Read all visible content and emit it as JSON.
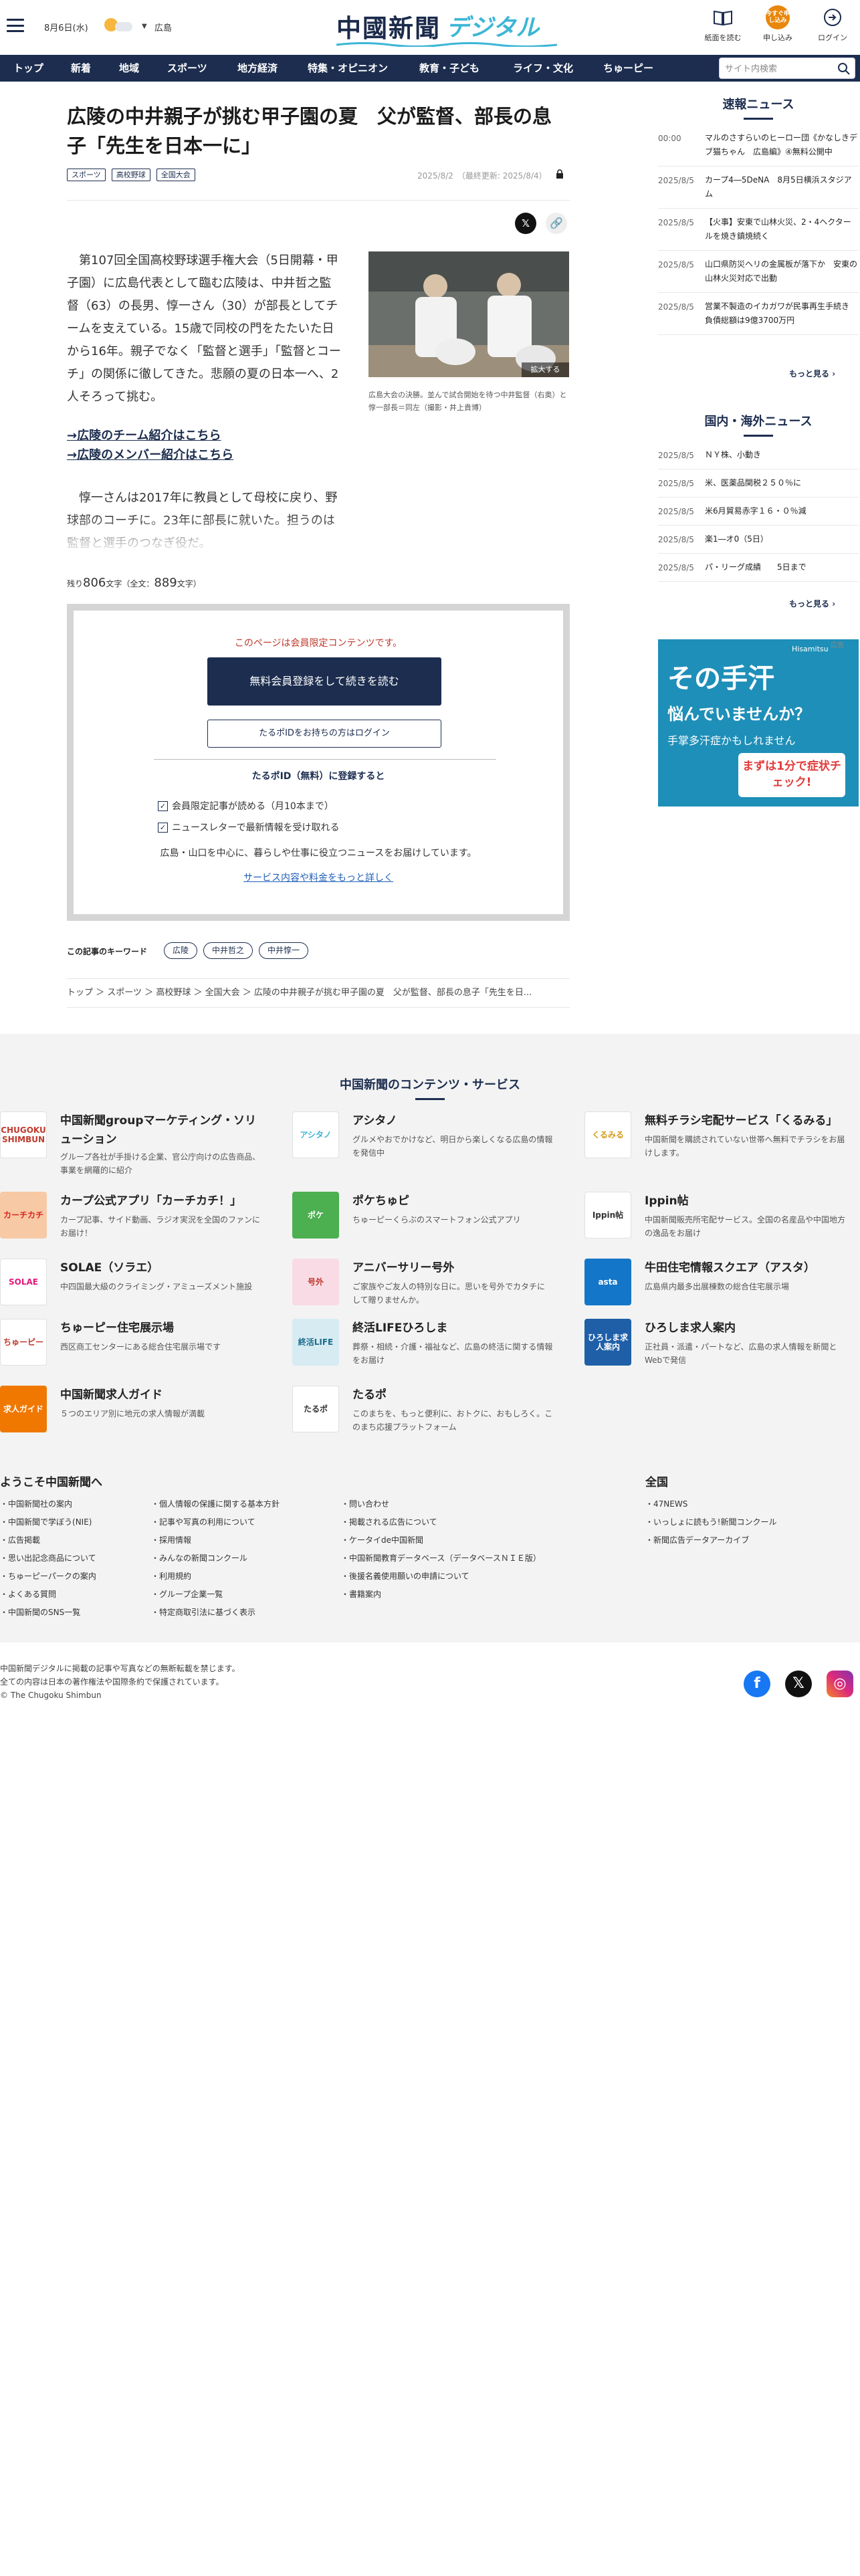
{
  "header": {
    "date": "8月6日(水)",
    "region": "広島",
    "logo_main": "中國新聞",
    "logo_sub": "デジタル",
    "buttons": [
      {
        "label": "紙面を読む",
        "icon": "newspaper-icon"
      },
      {
        "label": "申し込み",
        "icon": "apply-icon",
        "badge": "今すぐ申し込み"
      },
      {
        "label": "ログイン",
        "icon": "login-icon"
      }
    ]
  },
  "nav": {
    "items": [
      "トップ",
      "新着",
      "地域",
      "スポーツ",
      "地方経済",
      "特集・オピニオン",
      "教育・子ども",
      "ライフ・文化",
      "ちゅーピー"
    ],
    "search_placeholder": "サイト内検索"
  },
  "article": {
    "title": "広陵の中井親子が挑む甲子園の夏　父が監督、部長の息子「先生を日本一に」",
    "tags": [
      "スポーツ",
      "高校野球",
      "全国大会"
    ],
    "dateline": "2025/8/2　（最終更新: 2025/8/4）",
    "body1": "　第107回全国高校野球選手権大会（5日開幕・甲子園）に広島代表として臨む広陵は、中井哲之監督（63）の長男、惇一さん（30）が部長としてチームを支えている。15歳で同校の門をたたいた日から16年。親子でなく「監督と選手」「監督とコーチ」の関係に徹してきた。悲願の夏の日本一へ、2人そろって挑む。",
    "photo_zoom": "拡大する",
    "photo_caption": "広島大会の決勝。並んで試合開始を待つ中井監督（右奥）と惇一部長＝同左（撮影・井上貴博）",
    "link1": "→広陵のチーム紹介はこちら",
    "link2": "→広陵のメンバー紹介はこちら",
    "body2": "　惇一さんは2017年に教員として母校に戻り、野球部のコーチに。23年に部長に就いた。担うのは監督と選手のつなぎ役だ。",
    "remaining_label": "残り",
    "remaining_count": "806",
    "remaining_tail": "文字（全文：",
    "total_count": "889",
    "total_tail": "文字）"
  },
  "paywall": {
    "note": "このページは会員限定コンテンツです。",
    "register_button": "無料会員登録をして続きを読む",
    "login_button": "たるポIDをお持ちの方はログイン",
    "id_heading": "たるポID（無料）に登録すると",
    "benefits": [
      "会員限定記事が読める（月10本まで）",
      "ニュースレターで最新情報を受け取れる"
    ],
    "description": "広島・山口を中心に、暮らしや仕事に役立つニュースをお届けしています。",
    "more_link": "サービス内容や料金をもっと詳しく"
  },
  "keywords": {
    "label": "この記事のキーワード",
    "items": [
      "広陵",
      "中井哲之",
      "中井惇一"
    ]
  },
  "breadcrumb": {
    "items": [
      "トップ",
      "スポーツ",
      "高校野球",
      "全国大会",
      "広陵の中井親子が挑む甲子園の夏　父が監督、部長の息子「先生を日..."
    ]
  },
  "sidebar": {
    "flash_title": "速報ニュース",
    "flash": [
      {
        "date": "00:00",
        "text": "マルのさすらいのヒーロー団《かなしきデブ猫ちゃん　広島編》④無料公開中"
      },
      {
        "date": "2025/8/5",
        "text": "カープ4―5DeNA　8月5日横浜スタジアム"
      },
      {
        "date": "2025/8/5",
        "text": "【火事】安東で山林火災、2・4ヘクタールを焼き鎮焼続く"
      },
      {
        "date": "2025/8/5",
        "text": "山口県防災ヘリの金属板が落下か　安東の山林火災対応で出動"
      },
      {
        "date": "2025/8/5",
        "text": "営業不製造のイカガワが民事再生手続き　負債総額は9億3700万円"
      }
    ],
    "more": "もっと見る",
    "world_title": "国内・海外ニュース",
    "world": [
      {
        "date": "2025/8/5",
        "text": "ＮＹ株、小動き"
      },
      {
        "date": "2025/8/5",
        "text": "米、医薬品関税２５０％に"
      },
      {
        "date": "2025/8/5",
        "text": "米6月貿易赤字１６・０％減"
      },
      {
        "date": "2025/8/5",
        "text": "楽1―オ0（5日）"
      },
      {
        "date": "2025/8/5",
        "text": "パ・リーグ成績　　5日まで"
      }
    ],
    "ad_label": "広告",
    "ad": {
      "brand": "Hisamitsu",
      "line1": "その手汗",
      "line2": "悩んでいませんか？",
      "line3": "手掌多汗症かもしれません",
      "badge": "まずは1分で症状チェック!"
    }
  },
  "services": {
    "title": "中国新聞のコンテンツ・サービス",
    "items": [
      {
        "name": "中国新聞groupマーケティング・ソリューション",
        "desc": "グループ各社が手掛ける企業、官公庁向けの広告商品、事業を網羅的に紹介",
        "logo": "CHUGOKU SHIMBUN",
        "logo_bg": "#ffffff",
        "logo_fg": "#c0392b"
      },
      {
        "name": "アシタノ",
        "desc": "グルメやおでかけなど、明日から楽しくなる広島の情報を発信中",
        "logo": "アシタノ",
        "logo_bg": "#ffffff",
        "logo_fg": "#3cb6d6"
      },
      {
        "name": "無料チラシ宅配サービス「くるみる」",
        "desc": "中国新聞を購読されていない世帯へ無料でチラシをお届けします。",
        "logo": "くるみる",
        "logo_bg": "#ffffff",
        "logo_fg": "#d39a1c"
      },
      {
        "name": "カープ公式アプリ「カーチカチ！」",
        "desc": "カープ記事、サイド動画、ラジオ実況を全国のファンにお届け！",
        "logo": "カーチカチ",
        "logo_bg": "#f7c9a4",
        "logo_fg": "#d7261e"
      },
      {
        "name": "ポケちゅピ",
        "desc": "ちゅーピーくらぶのスマートフォン公式アプリ",
        "logo": "ポケ",
        "logo_bg": "#4caf50",
        "logo_fg": "#ffffff"
      },
      {
        "name": "Ippin帖",
        "desc": "中国新聞販売所宅配サービス。全国の名産品や中国地方の逸品をお届け",
        "logo": "Ippin帖",
        "logo_bg": "#ffffff",
        "logo_fg": "#333333"
      },
      {
        "name": "SOLAE（ソラエ）",
        "desc": "中四国最大級のクライミング・アミューズメント施設",
        "logo": "SOLAE",
        "logo_bg": "#ffffff",
        "logo_fg": "#e2197c"
      },
      {
        "name": "アニバーサリー号外",
        "desc": "ご家族やご友人の特別な日に。思いを号外でカタチにして贈りませんか。",
        "logo": "号外",
        "logo_bg": "#f9dbe5",
        "logo_fg": "#c0392b"
      },
      {
        "name": "牛田住宅情報スクエア（アスタ）",
        "desc": "広島県内最多出展棟数の総合住宅展示場",
        "logo": "asta",
        "logo_bg": "#1476c9",
        "logo_fg": "#ffffff"
      },
      {
        "name": "ちゅーピー住宅展示場",
        "desc": "西区商工センターにある総合住宅展示場です",
        "logo": "ちゅーピー",
        "logo_bg": "#ffffff",
        "logo_fg": "#c0392b"
      },
      {
        "name": "終活LIFEひろしま",
        "desc": "葬祭・相続・介護・福祉など、広島の終活に関する情報をお届け",
        "logo": "終活LIFE",
        "logo_bg": "#d6ecf2",
        "logo_fg": "#1c6c8c"
      },
      {
        "name": "ひろしま求人案内",
        "desc": "正社員・派遣・パートなど、広島の求人情報を新聞とWebで発信",
        "logo": "ひろしま求人案内",
        "logo_bg": "#1e5fa8",
        "logo_fg": "#ffffff"
      },
      {
        "name": "中国新聞求人ガイド",
        "desc": "５つのエリア別に地元の求人情報が満載",
        "logo": "求人ガイド",
        "logo_bg": "#f07800",
        "logo_fg": "#ffffff"
      },
      {
        "name": "たるポ",
        "desc": "このまちを、もっと便利に、おトクに、おもしろく。このまち応援プラットフォーム",
        "logo": "たるポ",
        "logo_bg": "#ffffff",
        "logo_fg": "#333333"
      }
    ]
  },
  "footer_links": {
    "title": "ようこそ中国新聞へ",
    "col1": [
      "中国新聞社の案内",
      "中国新聞で学ぼう(NIE)",
      "広告掲載",
      "思い出記念商品について",
      "ちゅーピーパークの案内",
      "よくある質問",
      "中国新聞のSNS一覧"
    ],
    "col2": [
      "個人情報の保護に関する基本方針",
      "記事や写真の利用について",
      "採用情報",
      "みんなの新聞コンクール",
      "利用規約",
      "グループ企業一覧",
      "特定商取引法に基づく表示"
    ],
    "col3": [
      "問い合わせ",
      "掲載される広告について",
      "ケータイde中国新聞",
      "中国新聞教育データベース（データベースＮＩＥ版）",
      "後援名義使用願いの申請について",
      "書籍案内"
    ],
    "zenkoku_title": "全国",
    "col4": [
      "47NEWS",
      "いっしょに読もう!新聞コンクール",
      "新聞広告データアーカイブ"
    ]
  },
  "footer": {
    "lines": [
      "中国新聞デジタルに掲載の記事や写真などの無断転載を禁じます。",
      "全ての内容は日本の著作権法や国際条約で保護されています。",
      "© The Chugoku Shimbun"
    ]
  },
  "colors": {
    "navy": "#1c2d4f",
    "accent_orange": "#e8870b",
    "paywall_red": "#c0392b",
    "facebook": "#1877f2",
    "instagram": "#d62976"
  }
}
